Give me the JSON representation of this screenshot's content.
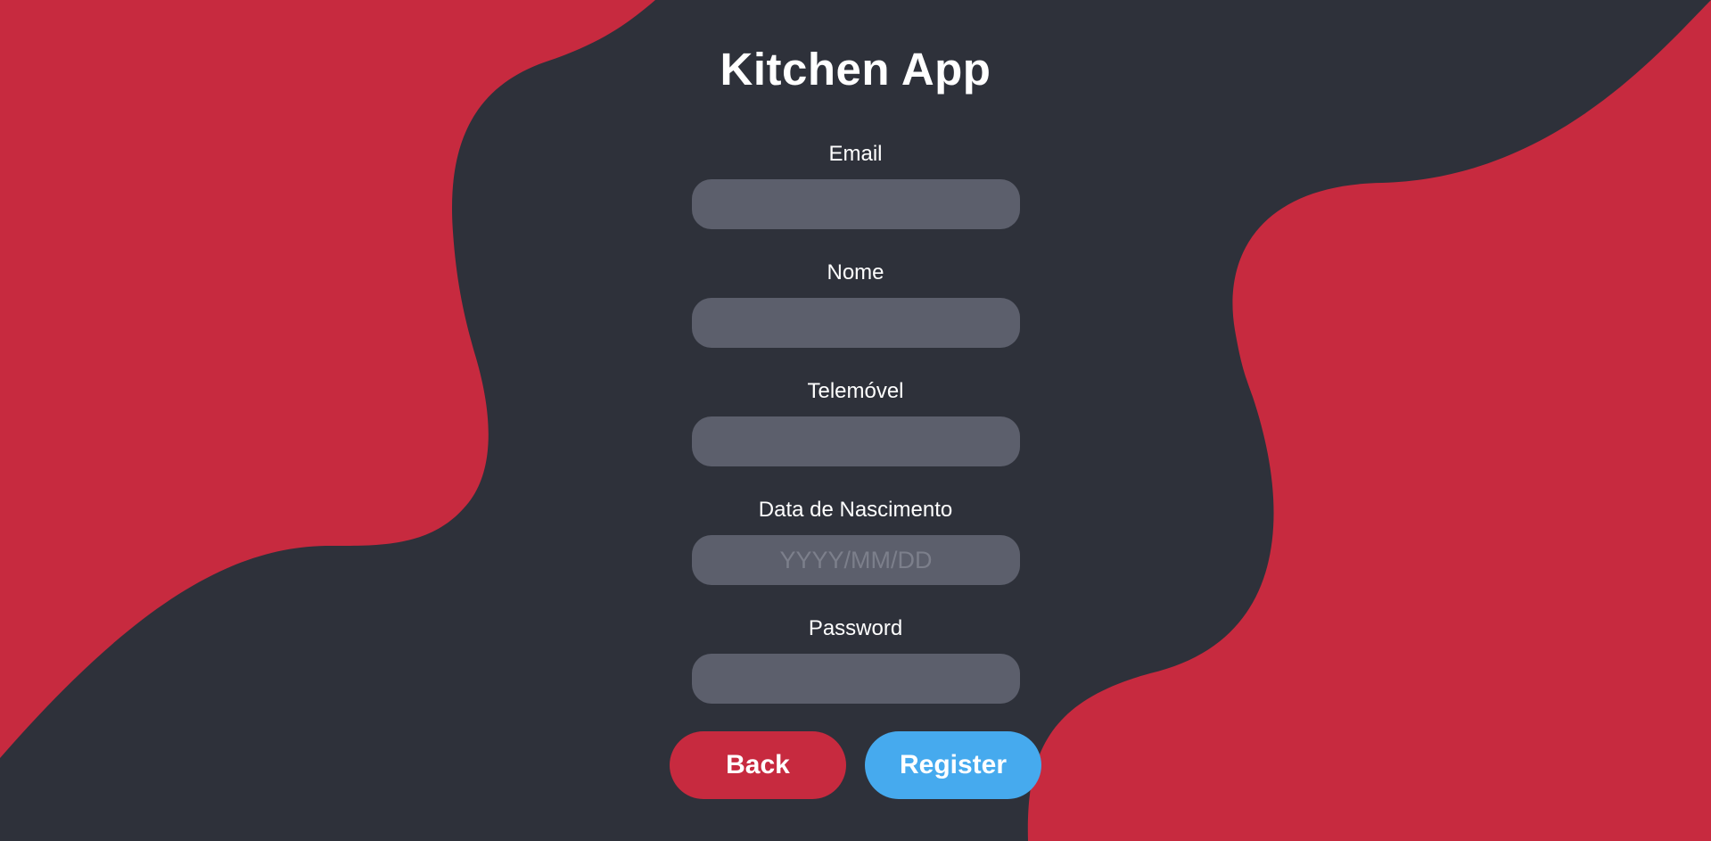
{
  "app": {
    "title": "Kitchen App"
  },
  "form": {
    "fields": [
      {
        "label": "Email",
        "value": "",
        "placeholder": "",
        "type": "text"
      },
      {
        "label": "Nome",
        "value": "",
        "placeholder": "",
        "type": "text"
      },
      {
        "label": "Telemóvel",
        "value": "",
        "placeholder": "",
        "type": "text"
      },
      {
        "label": "Data de Nascimento",
        "value": "",
        "placeholder": "YYYY/MM/DD",
        "type": "text"
      },
      {
        "label": "Password",
        "value": "",
        "placeholder": "",
        "type": "password"
      }
    ]
  },
  "buttons": {
    "back_label": "Back",
    "register_label": "Register"
  },
  "colors": {
    "background": "#2e313a",
    "accent_red": "#c72a3f",
    "input_fill": "#5c5f6c",
    "register_blue": "#46aaee"
  }
}
